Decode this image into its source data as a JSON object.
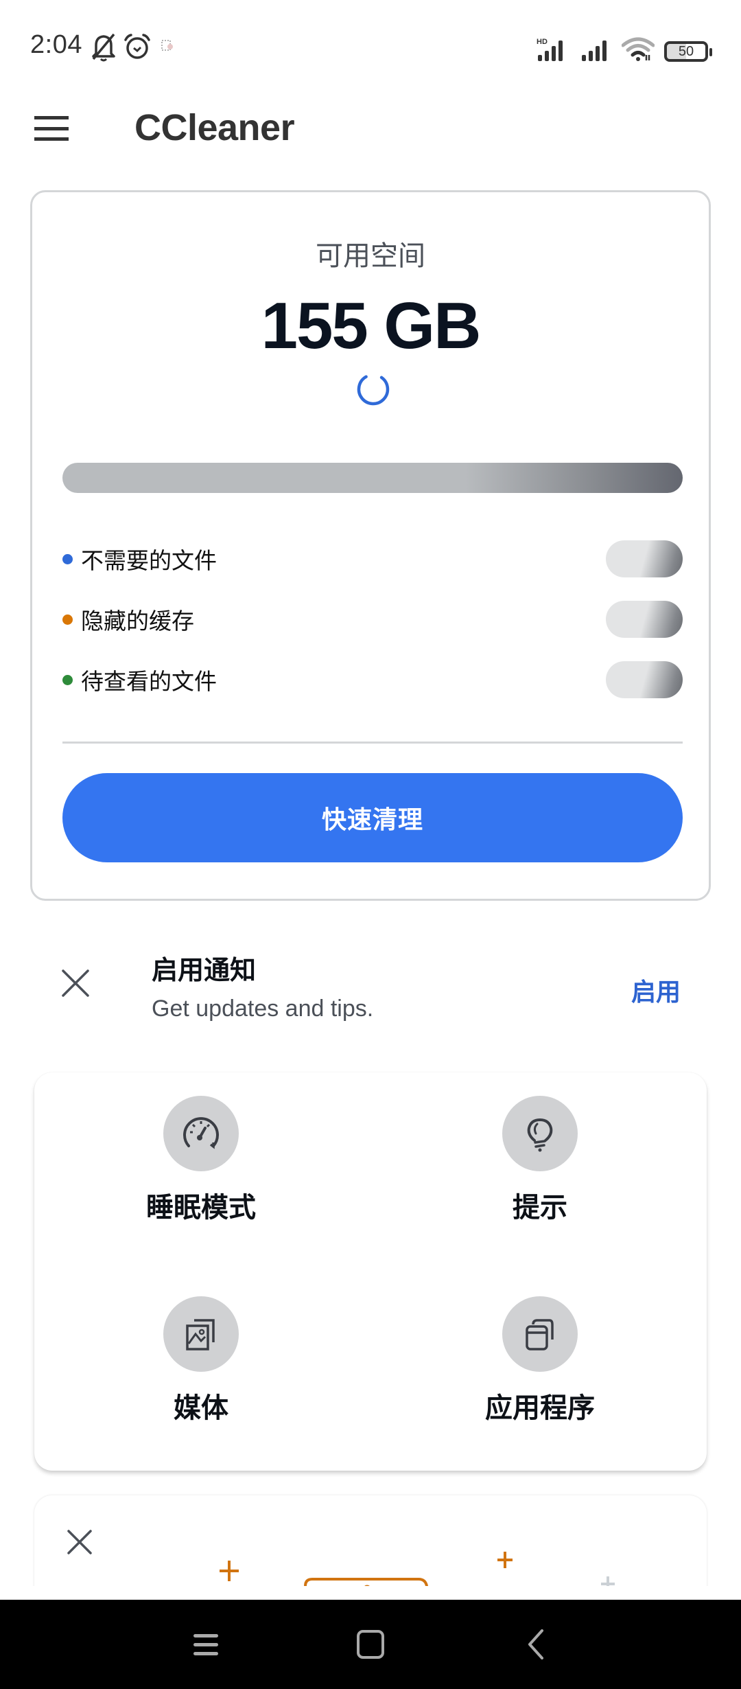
{
  "status_bar": {
    "time": "2:04",
    "icons": [
      "bell-off-icon",
      "alarm-icon",
      "app-notification-icon",
      "hd-signal-icon",
      "signal-icon",
      "wifi-icon",
      "battery-icon"
    ],
    "network_badge": "HD",
    "battery_level": "50"
  },
  "app_bar": {
    "menu_icon": "hamburger-menu-icon",
    "title": "CCleaner"
  },
  "storage_card": {
    "label": "可用空间",
    "value": "155 GB",
    "loading": true,
    "legend": [
      {
        "label": "不需要的文件",
        "color": "#2f6ad8"
      },
      {
        "label": "隐藏的缓存",
        "color": "#d97706"
      },
      {
        "label": "待查看的文件",
        "color": "#2e8b3a"
      }
    ],
    "quick_clean_label": "快速清理"
  },
  "notification_prompt": {
    "title": "启用通知",
    "subtitle": "Get updates and tips.",
    "enable_label": "启用",
    "close_icon": "close-icon"
  },
  "features": [
    {
      "label": "睡眠模式",
      "icon": "speedometer-icon"
    },
    {
      "label": "提示",
      "icon": "lightbulb-icon"
    },
    {
      "label": "媒体",
      "icon": "media-gallery-icon"
    },
    {
      "label": "应用程序",
      "icon": "apps-stack-icon"
    }
  ],
  "promo_card": {
    "close_icon": "close-icon",
    "illustration": "phone-illustration",
    "accent_color": "#d17410"
  },
  "nav_bar": {
    "buttons": [
      "recents-icon",
      "home-icon",
      "back-icon"
    ]
  },
  "colors": {
    "primary": "#3475f0",
    "link": "#2d63d0",
    "text_dark": "#0d1117"
  }
}
